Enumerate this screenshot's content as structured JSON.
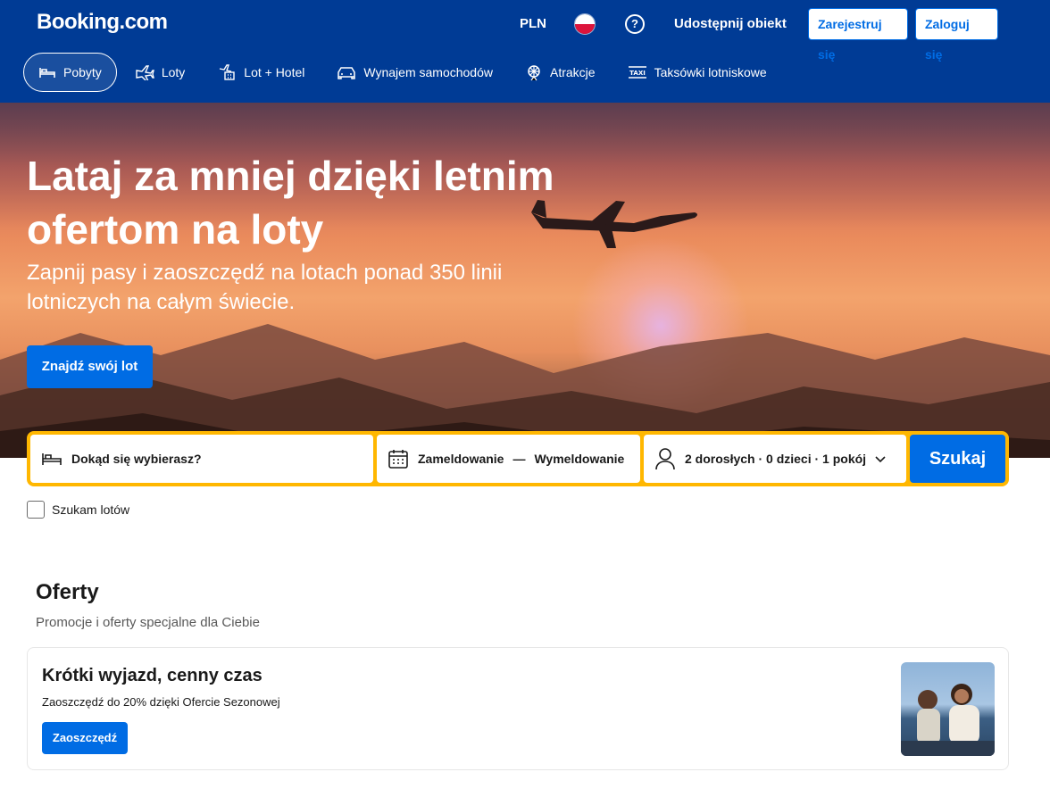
{
  "header": {
    "logo": "Booking.com",
    "currency": "PLN",
    "help_symbol": "?",
    "list_property": "Udostępnij obiekt",
    "register": "Zarejestruj się",
    "login": "Zaloguj się"
  },
  "nav": {
    "items": [
      {
        "label": "Pobyty",
        "icon": "bed-icon",
        "active": true
      },
      {
        "label": "Loty",
        "icon": "plane-icon"
      },
      {
        "label": "Lot + Hotel",
        "icon": "plane-hotel-icon"
      },
      {
        "label": "Wynajem samochodów",
        "icon": "car-icon"
      },
      {
        "label": "Atrakcje",
        "icon": "attractions-icon"
      },
      {
        "label": "Taksówki lotniskowe",
        "icon": "taxi-icon"
      }
    ]
  },
  "hero": {
    "title": "Lataj za mniej dzięki letnim ofertom na loty",
    "subtitle": "Zapnij pasy i zaoszczędź na lotach ponad 350 linii lotniczych na całym świecie.",
    "button": "Znajdź swój lot"
  },
  "search": {
    "destination_placeholder": "Dokąd się wybierasz?",
    "checkin": "Zameldowanie",
    "dash": "—",
    "checkout": "Wymeldowanie",
    "guests": "2 dorosłych · 0 dzieci · 1 pokój",
    "button": "Szukaj",
    "flights_checkbox": "Szukam lotów"
  },
  "offers": {
    "title": "Oferty",
    "subtitle": "Promocje i oferty specjalne dla Ciebie",
    "card": {
      "title": "Krótki wyjazd, cenny czas",
      "text": "Zaoszczędź do 20% dzięki Ofercie Sezonowej",
      "button": "Zaoszczędź"
    }
  },
  "colors": {
    "brand_blue": "#003b95",
    "action_blue": "#006ce4",
    "search_border": "#ffb700"
  }
}
